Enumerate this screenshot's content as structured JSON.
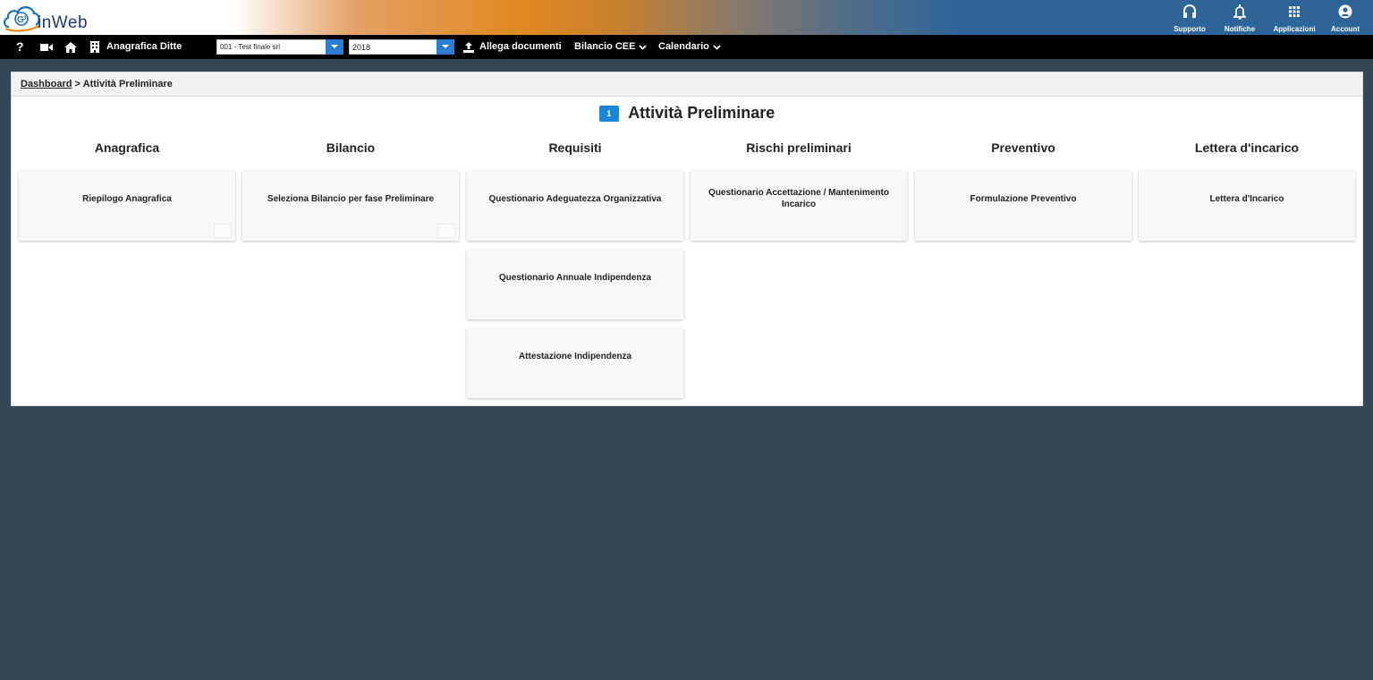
{
  "app": {
    "logo_text": "inWeb"
  },
  "header": {
    "buttons": [
      {
        "label": "Supporto",
        "icon": "headset-icon"
      },
      {
        "label": "Notifiche",
        "icon": "bell-icon"
      },
      {
        "label": "Applicazioni",
        "icon": "grid-icon"
      },
      {
        "label": "Account",
        "icon": "user-circle-icon"
      }
    ]
  },
  "toolbar": {
    "help": "?",
    "company_label": "Anagrafica Ditte",
    "company_value": "001 - Test finale srl",
    "year_value": "2018",
    "attach_label": "Allega documenti",
    "bilancio_label": "Bilancio CEE",
    "calendario_label": "Calendario"
  },
  "breadcrumb": {
    "link": "Dashboard",
    "separator": ">",
    "current": "Attività Preliminare"
  },
  "page": {
    "step_number": "1",
    "title": "Attività Preliminare"
  },
  "columns": [
    {
      "heading": "Anagrafica",
      "cards": [
        "Riepilogo Anagrafica"
      ]
    },
    {
      "heading": "Bilancio",
      "cards": [
        "Seleziona Bilancio per fase Preliminare"
      ]
    },
    {
      "heading": "Requisiti",
      "cards": [
        "Questionario Adeguatezza Organizzativa",
        "Questionario Annuale Indipendenza",
        "Attestazione Indipendenza"
      ]
    },
    {
      "heading": "Rischi preliminari",
      "cards": [
        "Questionario Accettazione / Mantenimento Incarico"
      ]
    },
    {
      "heading": "Preventivo",
      "cards": [
        "Formulazione Preventivo"
      ]
    },
    {
      "heading": "Lettera d'incarico",
      "cards": [
        "Lettera d'Incarico"
      ]
    }
  ],
  "colors": {
    "background": "#344756",
    "accent_blue": "#1a86d8",
    "header_orange": "#e2891f",
    "header_blue": "#2d6599"
  }
}
